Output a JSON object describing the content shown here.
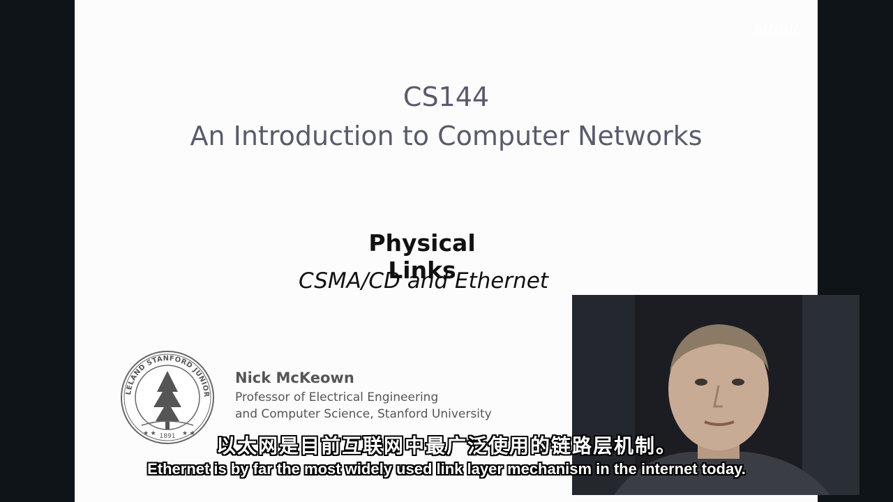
{
  "slide": {
    "course_code": "CS144",
    "course_title": "An Introduction to Computer Networks",
    "topic_title": "Physical Links",
    "topic_subtitle": "CSMA/CD and Ethernet"
  },
  "seal": {
    "ring_text": "LELAND STANFORD JUNIOR UNIVERSITY",
    "motto": "DIE LUFT DER FREIHEIT WEHT",
    "year": "1891"
  },
  "presenter": {
    "name": "Nick McKeown",
    "role_line1": "Professor of Electrical Engineering",
    "role_line2": "and Computer Science, Stanford University"
  },
  "overlay": {
    "watermark": "bilibili"
  },
  "subtitles": {
    "zh": "以太网是目前互联网中最广泛使用的链路层机制。",
    "en": "Ethernet is by far the most widely used link layer mechanism in the internet today."
  },
  "colors": {
    "slide_bg": "#fcfcfc",
    "course_text": "#5a5a6e",
    "frame_bg": "#0f1419"
  }
}
